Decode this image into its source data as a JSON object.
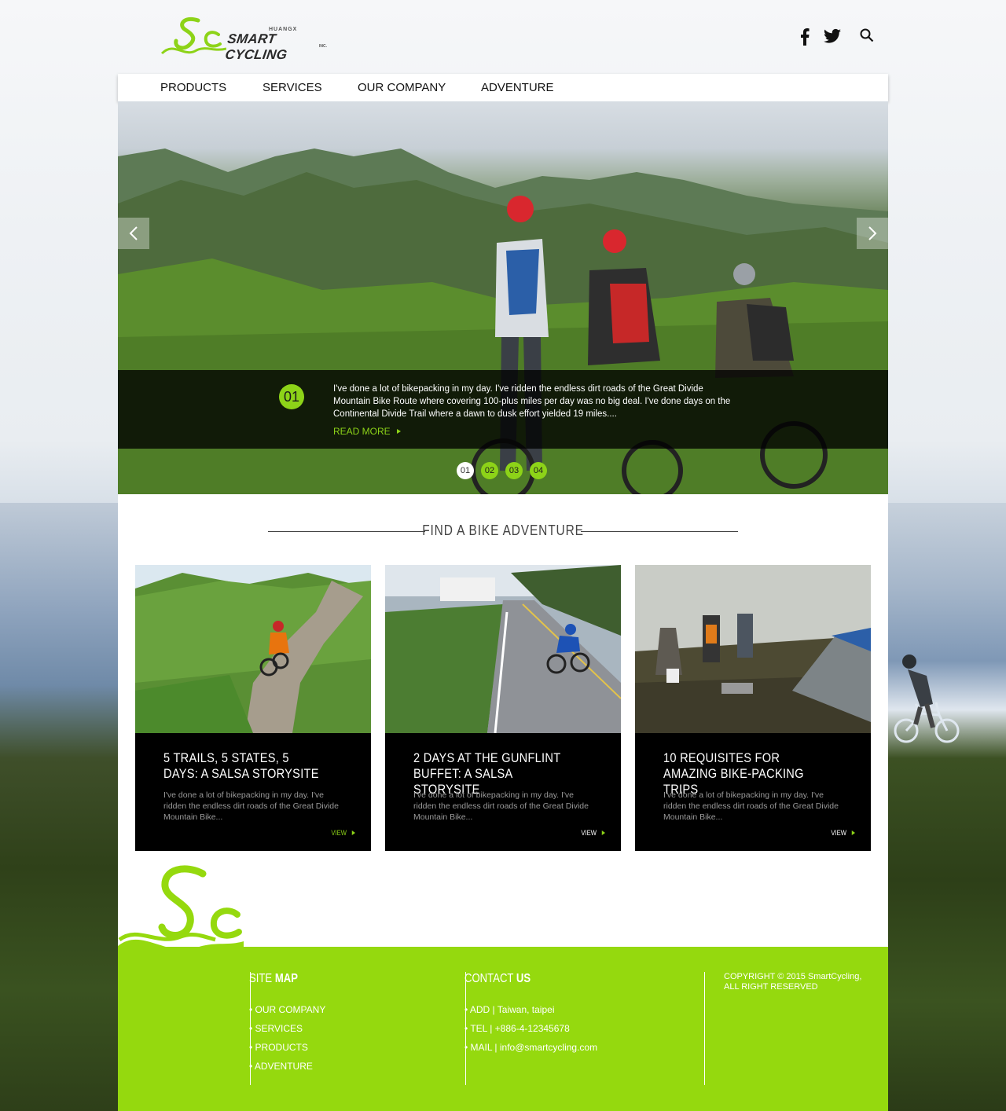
{
  "header": {
    "brand_small": "HUANGX",
    "brand": "SMART CYCLING",
    "brand_suffix": "INC.",
    "social": [
      "facebook-icon",
      "twitter-icon",
      "search-icon"
    ]
  },
  "nav": {
    "items": [
      "PRODUCTS",
      "SERVICES",
      "OUR COMPANY",
      "ADVENTURE"
    ]
  },
  "hero": {
    "slide_number": "01",
    "text": "I've done a lot of bikepacking in my day. I've ridden the endless dirt roads of the Great Divide Mountain Bike Route where covering 100-plus miles per day was no big deal. I've done days on the Continental Divide Trail where a dawn to dusk effort yielded 19 miles....",
    "read_more": "READ MORE",
    "dots": [
      "01",
      "02",
      "03",
      "04"
    ],
    "active_dot": "01"
  },
  "section": {
    "title": "FIND A BIKE ADVENTURE"
  },
  "cards": [
    {
      "title": "5 TRAILS, 5 STATES, 5 DAYS: A SALSA STORYSITE",
      "text": "I've done a lot of bikepacking in my day. I've ridden the endless dirt roads of the Great Divide Mountain Bike...",
      "view": "VIEW",
      "view_color": "#8dd318"
    },
    {
      "title": "2 DAYS AT THE GUNFLINT BUFFET: A SALSA STORYSITE",
      "text": "I've done a lot of bikepacking in my day. I've ridden the endless dirt roads of the Great Divide Mountain Bike...",
      "view": "VIEW",
      "view_color": "#ffffff"
    },
    {
      "title": "10 REQUISITES FOR AMAZING BIKE-PACKING TRIPS",
      "text": "I've done a lot of bikepacking in my day. I've ridden the endless dirt roads of the Great Divide Mountain Bike...",
      "view": "VIEW",
      "view_color": "#ffffff"
    }
  ],
  "footer": {
    "sitemap": {
      "head_light": "SITE",
      "head_bold": "MAP",
      "items": [
        "• OUR COMPANY",
        "• SERVICES",
        "• PRODUCTS",
        "• ADVENTURE"
      ]
    },
    "contact": {
      "head_light": "CONTACT",
      "head_bold": "US",
      "items": [
        "• ADD | Taiwan, taipei",
        "• TEL | +886-4-12345678",
        "• MAIL | info@smartcycling.com"
      ]
    },
    "copyright": "COPYRIGHT © 2015 SmartCycling, ALL RIGHT RESERVED"
  },
  "colors": {
    "accent": "#8dd318",
    "footer_bg": "#95d90e",
    "dark": "#000000"
  }
}
